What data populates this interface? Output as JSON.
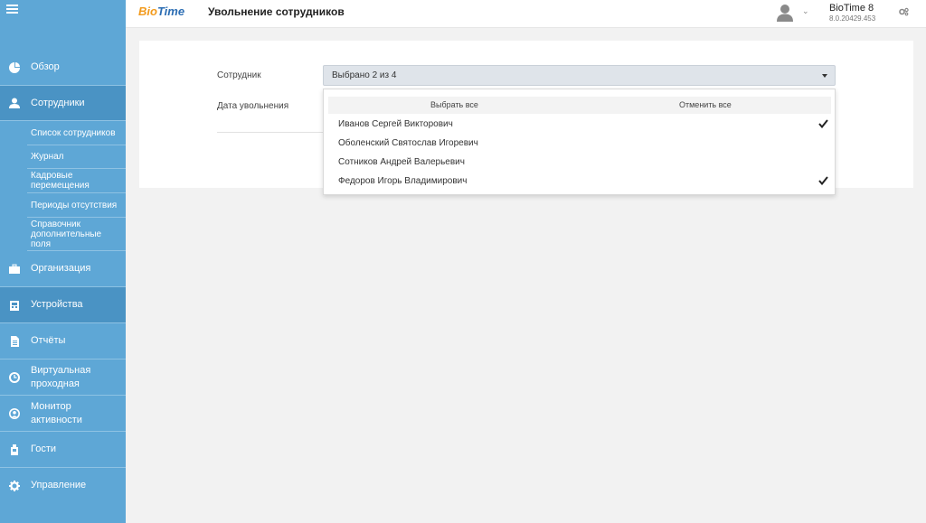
{
  "header": {
    "logo_bio": "Bio",
    "logo_time": "Time",
    "page_title": "Увольнение сотрудников",
    "app_name": "BioTime 8",
    "app_version": "8.0.20429.453"
  },
  "sidebar": {
    "items": [
      {
        "label": "Обзор",
        "icon": "pie-chart-icon"
      },
      {
        "label": "Сотрудники",
        "icon": "user-icon",
        "active": true
      },
      {
        "label": "Организация",
        "icon": "briefcase-icon"
      },
      {
        "label": "Устройства",
        "icon": "device-icon"
      },
      {
        "label": "Отчёты",
        "icon": "report-icon"
      },
      {
        "label": "Виртуальная проходная",
        "icon": "clock-icon"
      },
      {
        "label": "Монитор активности",
        "icon": "user-circle-icon"
      },
      {
        "label": "Гости",
        "icon": "guest-icon"
      },
      {
        "label": "Управление",
        "icon": "gear-icon"
      }
    ],
    "subitems": [
      {
        "label": "Список сотрудников"
      },
      {
        "label": "Журнал"
      },
      {
        "label": "Кадровые перемещения"
      },
      {
        "label": "Периоды отсутствия"
      },
      {
        "label": "Справочник дополнительные поля"
      }
    ]
  },
  "form": {
    "employee_label": "Сотрудник",
    "dismiss_date_label": "Дата увольнения",
    "employee_value": "Выбрано 2 из 4"
  },
  "dropdown": {
    "select_all": "Выбрать все",
    "deselect_all": "Отменить все",
    "options": [
      {
        "name": "Иванов Сергей Викторович",
        "checked": true
      },
      {
        "name": "Оболенский Святослав Игоревич",
        "checked": false
      },
      {
        "name": "Сотников Андрей Валерьевич",
        "checked": false
      },
      {
        "name": "Федоров Игорь Владимирович",
        "checked": true
      }
    ]
  }
}
